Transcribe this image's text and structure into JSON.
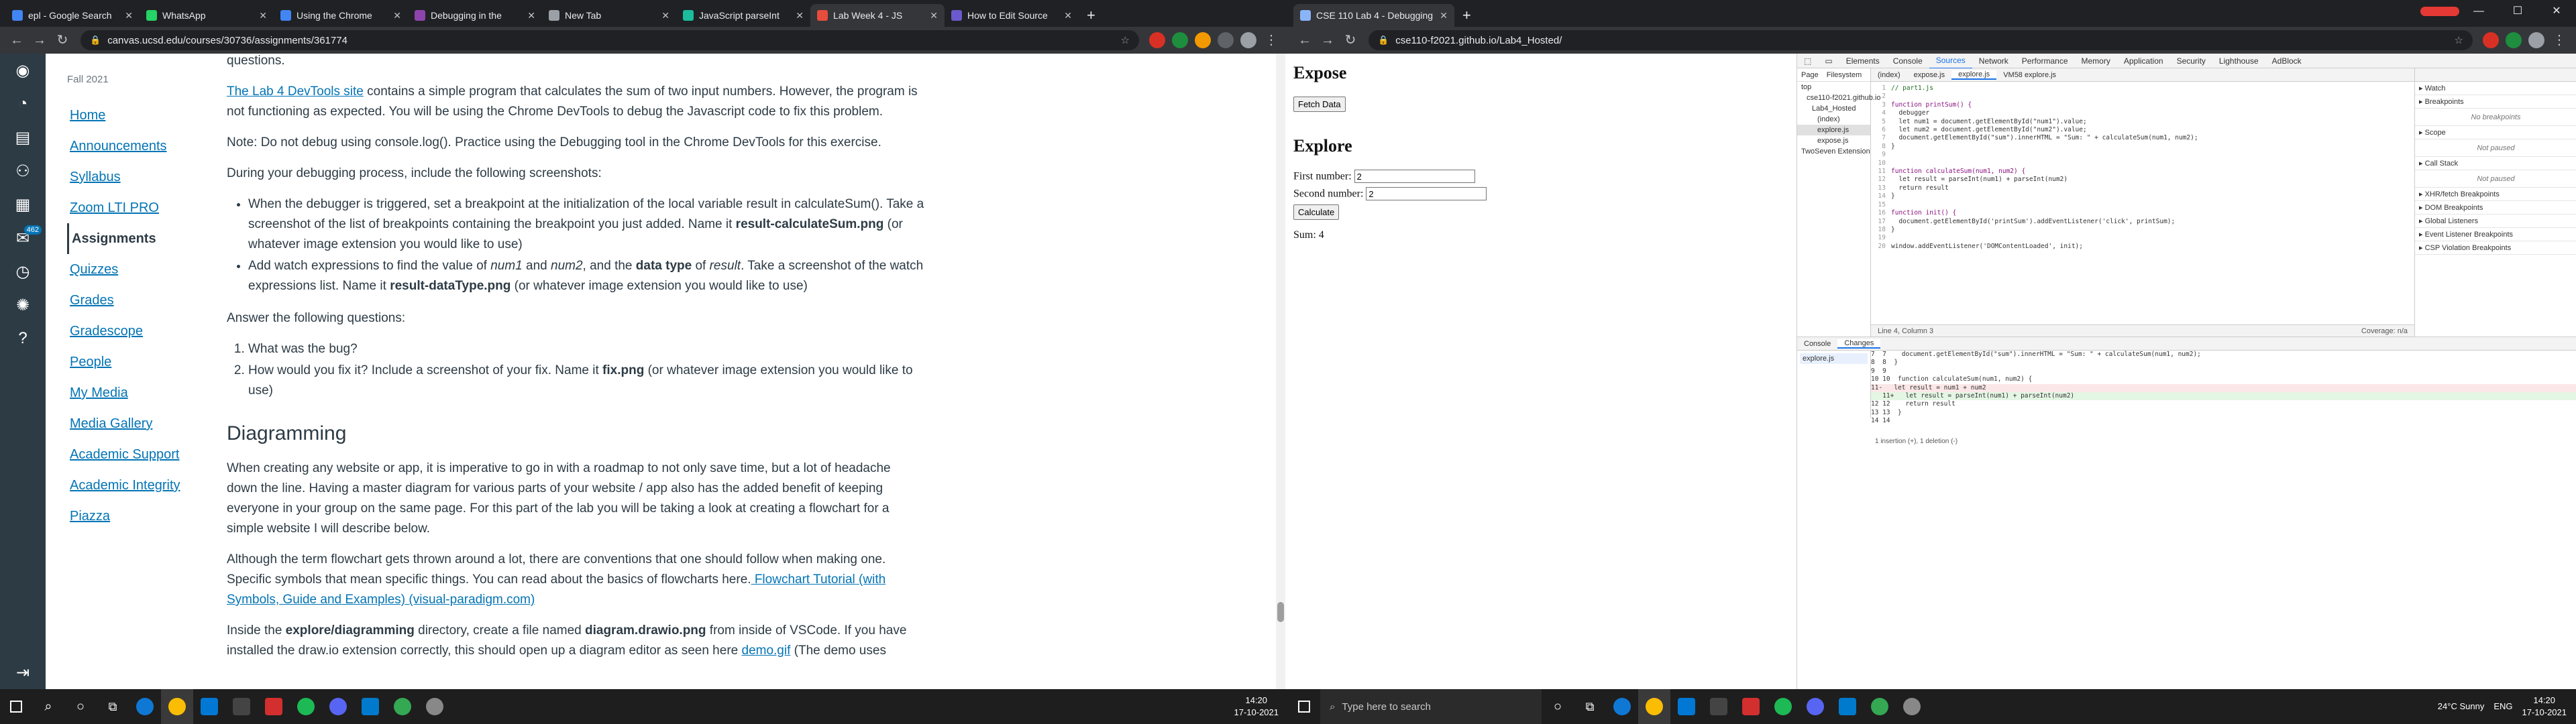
{
  "left": {
    "tabs": [
      {
        "label": "epl - Google Search",
        "color": "#4285f4"
      },
      {
        "label": "WhatsApp",
        "color": "#25d366"
      },
      {
        "label": "Using the Chrome",
        "color": "#4285f4"
      },
      {
        "label": "Debugging in the",
        "color": "#8e44ad"
      },
      {
        "label": "New Tab",
        "color": "#9aa0a6"
      },
      {
        "label": "JavaScript parseInt",
        "color": "#1abc9c"
      },
      {
        "label": "Lab Week 4 - JS",
        "color": "#e74c3c",
        "active": true
      },
      {
        "label": "How to Edit Source",
        "color": "#6a5acd"
      }
    ],
    "url": "canvas.ucsd.edu/courses/30736/assignments/361774",
    "term": "Fall 2021",
    "course_nav": [
      "Home",
      "Announcements",
      "Syllabus",
      "Zoom LTI PRO",
      "Assignments",
      "Quizzes",
      "Grades",
      "Gradescope",
      "People",
      "My Media",
      "Media Gallery",
      "Academic Support",
      "Academic Integrity",
      "Piazza"
    ],
    "badge": "462",
    "content": {
      "top_fragment": "questions.",
      "p1_link": "The Lab 4 DevTools site",
      "p1_text": " contains a simple program that calculates the sum of two input numbers. However, the program is not functioning as expected. You will be using the Chrome DevTools to debug the Javascript code to fix this problem.",
      "p2": "Note: Do not debug using console.log(). Practice using the Debugging tool in the Chrome DevTools for this exercise.",
      "p3": "During your debugging process, include the following screenshots:",
      "bullet1_a": "When the debugger is triggered, set a breakpoint at the initialization of the local variable result in calculateSum(). Take a screenshot of the list of breakpoints containing the breakpoint you just added. Name it ",
      "bullet1_b": "result-calculateSum.png",
      "bullet1_c": " (or whatever image extension you would like to use)",
      "bullet2_a": "Add watch expressions to find the value of ",
      "bullet2_b": "num1",
      "bullet2_c": " and ",
      "bullet2_d": "num2",
      "bullet2_e": ", and the ",
      "bullet2_f": "data type",
      "bullet2_g": " of ",
      "bullet2_h": "result",
      "bullet2_i": ". Take a screenshot of the watch expressions list. Name it ",
      "bullet2_j": "result-dataType.png",
      "bullet2_k": " (or whatever image extension you would like to use)",
      "p4": "Answer the following questions:",
      "q1": "What was the bug?",
      "q2_a": "How would you fix it? Include a screenshot of your fix. Name it ",
      "q2_b": "fix.png",
      "q2_c": " (or whatever image extension you would like to use)",
      "h2": "Diagramming",
      "p5": "When creating any website or app, it is imperative to go in with a roadmap to not only save time, but a lot of headache down the line. Having a master diagram for various parts of your website / app also has the added benefit of keeping everyone in your group on the same page. For this part of the lab you will be taking a look at creating a flowchart for a simple website I will describe below.",
      "p6_a": "Although the term flowchart gets thrown around a lot, there are conventions that one should follow when making one. Specific symbols that mean specific things. You can read about the basics of flowcharts here.",
      "p6_link": " Flowchart Tutorial (with Symbols, Guide and Examples) (visual-paradigm.com)",
      "p7_a": "Inside the ",
      "p7_b": "explore/diagramming",
      "p7_c": " directory, create a file named ",
      "p7_d": "diagram.drawio.png",
      "p7_e": " from inside of VSCode. If you have installed the draw.io extension correctly, this should open up a diagram editor as seen here ",
      "p7_link": "demo.gif",
      "p7_f": " (The demo uses"
    },
    "taskbar": {
      "time": "14:20",
      "date": "17-10-2021"
    }
  },
  "right": {
    "tab": {
      "label": "CSE 110 Lab 4 - Debugging"
    },
    "url": "cse110-f2021.github.io/Lab4_Hosted/",
    "page": {
      "h1_expose": "Expose",
      "fetch_btn": "Fetch Data",
      "h1_explore": "Explore",
      "first_label": "First number:",
      "first_value": "2",
      "second_label": "Second number:",
      "second_value": "2",
      "calc_btn": "Calculate",
      "sum": "Sum: 4"
    },
    "devtools": {
      "tabs": [
        "Elements",
        "Console",
        "Sources",
        "Network",
        "Performance",
        "Memory",
        "Application",
        "Security",
        "Lighthouse",
        "AdBlock"
      ],
      "active_tab": "Sources",
      "file_tabs": [
        "Page",
        "Filesystem"
      ],
      "tree": [
        "top",
        "cse110-f2021.github.io",
        "Lab4_Hosted",
        "(index)",
        "explore.js",
        "expose.js",
        "TwoSeven Extension"
      ],
      "editor_tabs": [
        "(index)",
        "expose.js",
        "explore.js",
        "VM58 explore.js"
      ],
      "code": [
        "// part1.js",
        "",
        "function printSum() {",
        "  debugger",
        "  let num1 = document.getElementById(\"num1\").value;",
        "  let num2 = document.getElementById(\"num2\").value;",
        "  document.getElementById(\"sum\").innerHTML = \"Sum: \" + calculateSum(num1, num2);",
        "}",
        "",
        "",
        "function calculateSum(num1, num2) {",
        "  let result = parseInt(num1) + parseInt(num2)",
        "  return result",
        "}",
        "",
        "function init() {",
        "  document.getElementById('printSum').addEventListener('click', printSum);",
        "}",
        "",
        "window.addEventListener('DOMContentLoaded', init);"
      ],
      "status": "Line 4, Column 3",
      "coverage": "Coverage: n/a",
      "debug_sections": [
        "Watch",
        "Breakpoints",
        "Scope",
        "Call Stack",
        "XHR/fetch Breakpoints",
        "DOM Breakpoints",
        "Global Listeners",
        "Event Listener Breakpoints",
        "CSP Violation Breakpoints"
      ],
      "no_breakpoints": "No breakpoints",
      "not_paused": "Not paused",
      "drawer_tabs": [
        "Console",
        "Changes"
      ],
      "changed_file": "explore.js",
      "diff": [
        {
          "ln": "7  7",
          "kind": "ctx",
          "text": "    document.getElementById(\"sum\").innerHTML = \"Sum: \" + calculateSum(num1, num2);"
        },
        {
          "ln": "8  8",
          "kind": "ctx",
          "text": "  }"
        },
        {
          "ln": "9  9",
          "kind": "ctx",
          "text": ""
        },
        {
          "ln": "10 10",
          "kind": "ctx",
          "text": "  function calculateSum(num1, num2) {"
        },
        {
          "ln": "11",
          "kind": "del",
          "text": "-   let result = num1 + num2"
        },
        {
          "ln": "   11",
          "kind": "add",
          "text": "+   let result = parseInt(num1) + parseInt(num2)"
        },
        {
          "ln": "12 12",
          "kind": "ctx",
          "text": "    return result"
        },
        {
          "ln": "13 13",
          "kind": "ctx",
          "text": "  }"
        },
        {
          "ln": "14 14",
          "kind": "ctx",
          "text": ""
        }
      ],
      "diff_summary": "1 insertion (+), 1 deletion (-)"
    },
    "taskbar": {
      "search": "Type here to search",
      "weather": "24°C Sunny",
      "lang": "ENG",
      "time": "14:20",
      "date": "17-10-2021"
    }
  }
}
